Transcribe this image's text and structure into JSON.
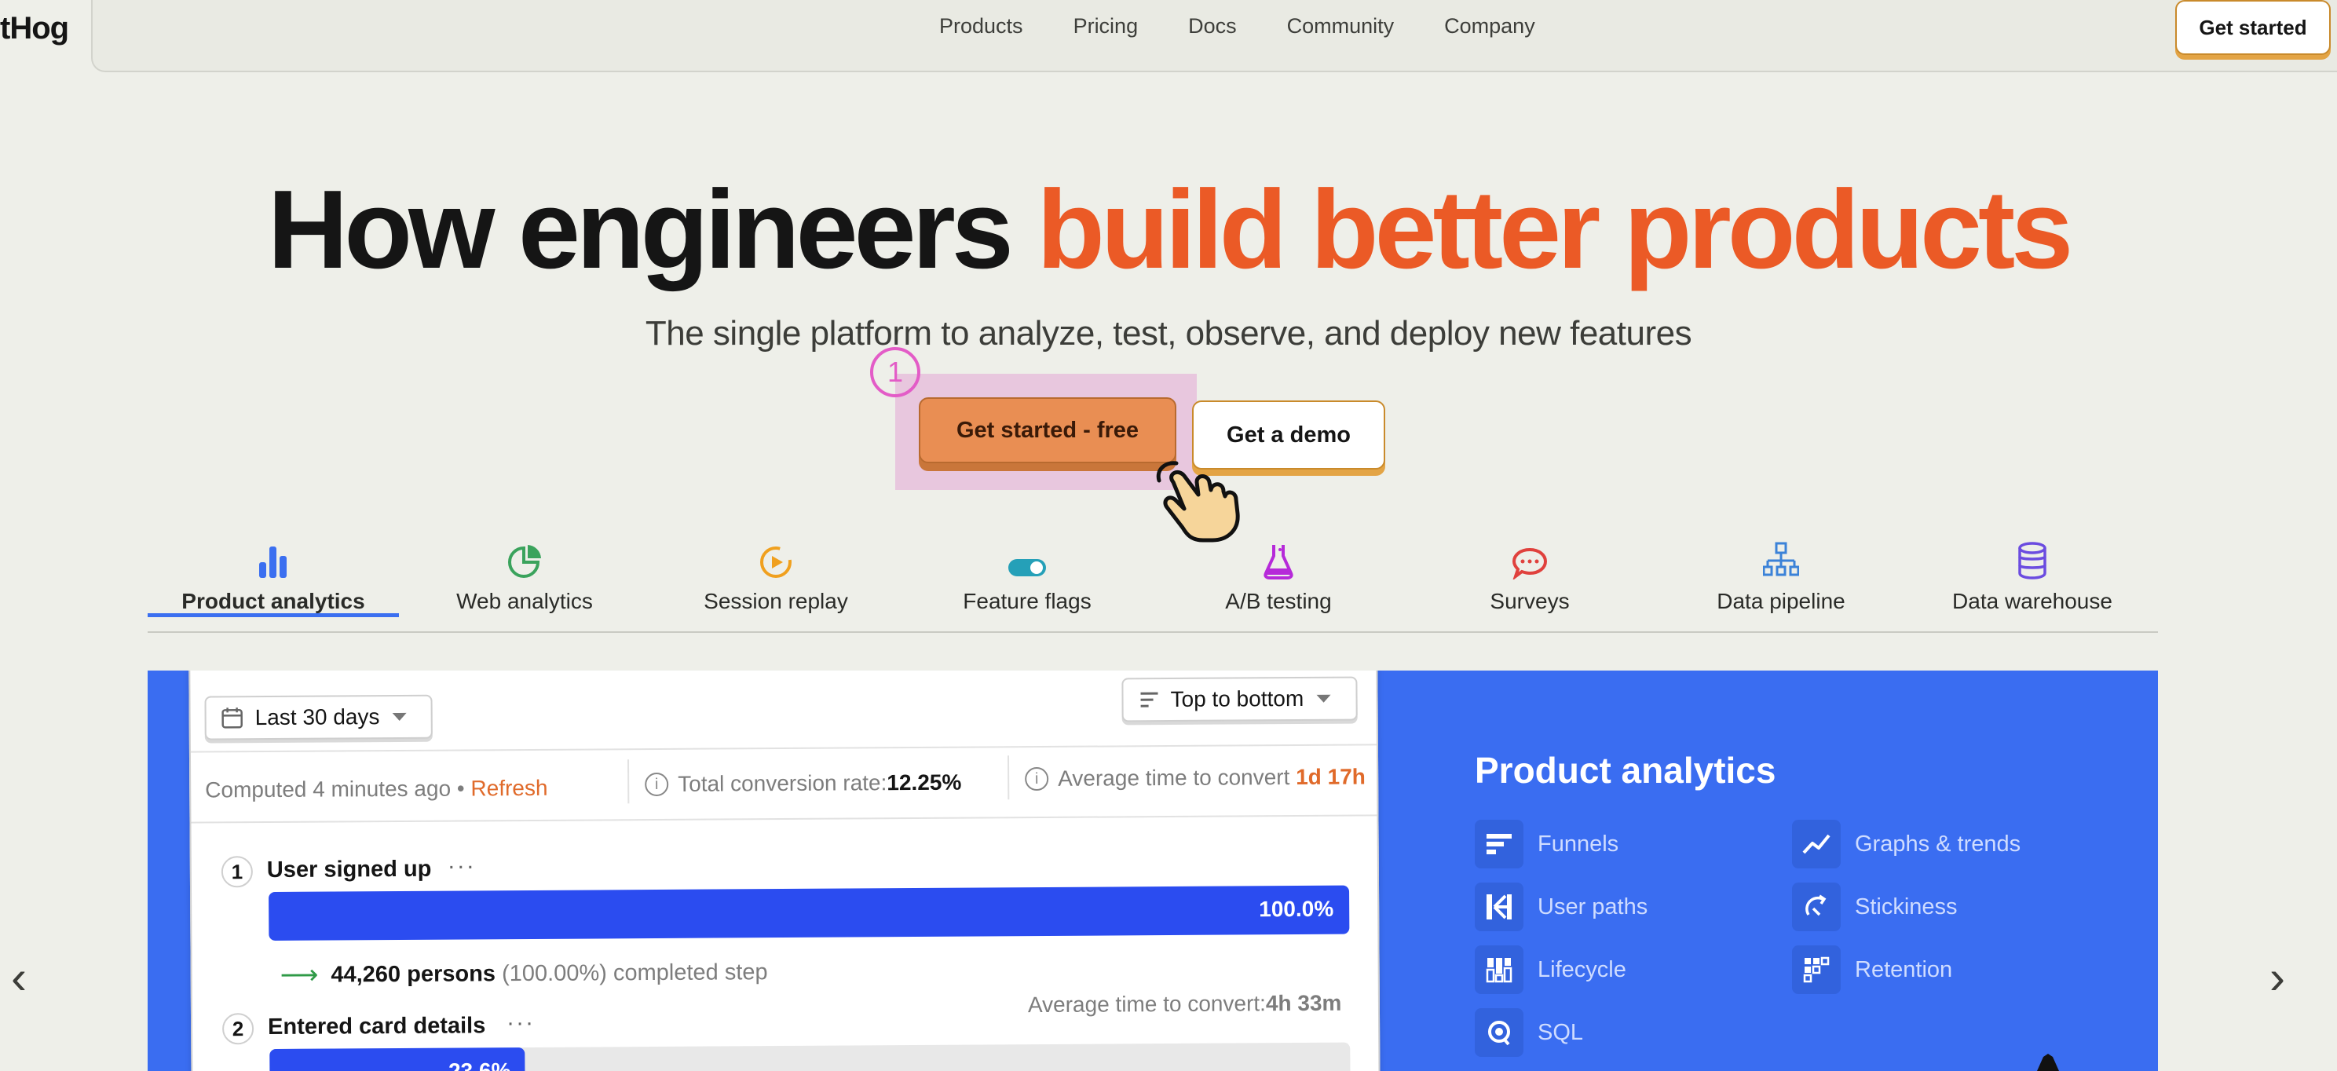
{
  "nav": {
    "brand": "tHog",
    "links": [
      "Products",
      "Pricing",
      "Docs",
      "Community",
      "Company"
    ],
    "cta": "Get started"
  },
  "hero": {
    "title_dark": "How engineers ",
    "title_accent": "build better products",
    "subtitle": "The single platform to analyze, test, observe, and deploy new features",
    "primary_cta": "Get started - free",
    "secondary_cta": "Get a demo",
    "step_marker": "1"
  },
  "tabs": [
    {
      "label": "Product analytics",
      "icon": "bar-chart-icon",
      "color": "#3b6ff0"
    },
    {
      "label": "Web analytics",
      "icon": "pie-chart-icon",
      "color": "#3aa35c"
    },
    {
      "label": "Session replay",
      "icon": "replay-icon",
      "color": "#f0a01e"
    },
    {
      "label": "Feature flags",
      "icon": "toggle-icon",
      "color": "#25a0b8"
    },
    {
      "label": "A/B testing",
      "icon": "flask-icon",
      "color": "#b62ad9"
    },
    {
      "label": "Surveys",
      "icon": "chat-bubble-icon",
      "color": "#e0413d"
    },
    {
      "label": "Data pipeline",
      "icon": "pipeline-icon",
      "color": "#3b82d8"
    },
    {
      "label": "Data warehouse",
      "icon": "database-icon",
      "color": "#6b4ce0"
    }
  ],
  "funnel": {
    "date_range": "Last 30 days",
    "order": "Top to bottom",
    "computed": "Computed 4 minutes ago",
    "refresh": "Refresh",
    "total_conv_label": "Total conversion rate:",
    "total_conv_value": "12.25%",
    "avg_time_label": "Average time to convert",
    "avg_time_value": "1d 17h",
    "steps": [
      {
        "num": "1",
        "name": "User signed up",
        "percent": "100.0%",
        "persons": "44,260 persons",
        "persons_pct": "(100.00%)",
        "suffix": "completed step"
      },
      {
        "num": "2",
        "name": "Entered card details",
        "percent": "23.6%",
        "avg_label": "Average time to convert:",
        "avg_value": "4h 33m"
      }
    ]
  },
  "features": {
    "title": "Product analytics",
    "items": [
      {
        "label": "Funnels",
        "icon": "funnel-icon"
      },
      {
        "label": "Graphs & trends",
        "icon": "trend-line-icon"
      },
      {
        "label": "User paths",
        "icon": "paths-icon"
      },
      {
        "label": "Stickiness",
        "icon": "stickiness-icon"
      },
      {
        "label": "Lifecycle",
        "icon": "lifecycle-icon"
      },
      {
        "label": "Retention",
        "icon": "retention-icon"
      },
      {
        "label": "SQL",
        "icon": "sql-icon"
      }
    ]
  },
  "carousel": {
    "prev": "‹",
    "next": "›"
  }
}
